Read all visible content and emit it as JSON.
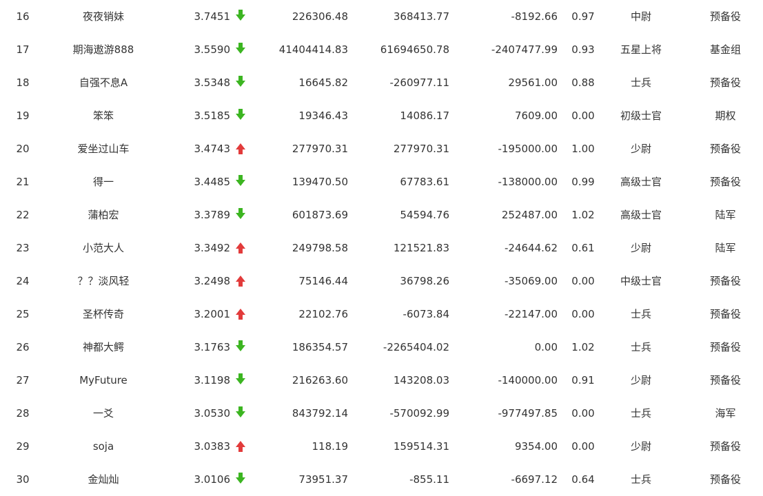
{
  "colors": {
    "text": "#333333",
    "down_arrow": "#3cb521",
    "up_arrow": "#e23b3b",
    "background": "#ffffff"
  },
  "rows": [
    {
      "rank": "16",
      "name": "夜夜销妹",
      "score": "3.7451",
      "trend": "down",
      "v1": "226306.48",
      "v2": "368413.77",
      "v3": "-8192.66",
      "ratio": "0.97",
      "level": "中尉",
      "group": "预备役"
    },
    {
      "rank": "17",
      "name": "期海遨游888",
      "score": "3.5590",
      "trend": "down",
      "v1": "41404414.83",
      "v2": "61694650.78",
      "v3": "-2407477.99",
      "ratio": "0.93",
      "level": "五星上将",
      "group": "基金组"
    },
    {
      "rank": "18",
      "name": "自强不息A",
      "score": "3.5348",
      "trend": "down",
      "v1": "16645.82",
      "v2": "-260977.11",
      "v3": "29561.00",
      "ratio": "0.88",
      "level": "士兵",
      "group": "预备役"
    },
    {
      "rank": "19",
      "name": "笨笨",
      "score": "3.5185",
      "trend": "down",
      "v1": "19346.43",
      "v2": "14086.17",
      "v3": "7609.00",
      "ratio": "0.00",
      "level": "初级士官",
      "group": "期权"
    },
    {
      "rank": "20",
      "name": "爱坐过山车",
      "score": "3.4743",
      "trend": "up",
      "v1": "277970.31",
      "v2": "277970.31",
      "v3": "-195000.00",
      "ratio": "1.00",
      "level": "少尉",
      "group": "预备役"
    },
    {
      "rank": "21",
      "name": "得一",
      "score": "3.4485",
      "trend": "down",
      "v1": "139470.50",
      "v2": "67783.61",
      "v3": "-138000.00",
      "ratio": "0.99",
      "level": "高级士官",
      "group": "预备役"
    },
    {
      "rank": "22",
      "name": "蒲柏宏",
      "score": "3.3789",
      "trend": "down",
      "v1": "601873.69",
      "v2": "54594.76",
      "v3": "252487.00",
      "ratio": "1.02",
      "level": "高级士官",
      "group": "陆军"
    },
    {
      "rank": "23",
      "name": "小范大人",
      "score": "3.3492",
      "trend": "up",
      "v1": "249798.58",
      "v2": "121521.83",
      "v3": "-24644.62",
      "ratio": "0.61",
      "level": "少尉",
      "group": "陆军"
    },
    {
      "rank": "24",
      "name": "？？淡风轻",
      "score": "3.2498",
      "trend": "up",
      "v1": "75146.44",
      "v2": "36798.26",
      "v3": "-35069.00",
      "ratio": "0.00",
      "level": "中级士官",
      "group": "预备役"
    },
    {
      "rank": "25",
      "name": "圣杯传奇",
      "score": "3.2001",
      "trend": "up",
      "v1": "22102.76",
      "v2": "-6073.84",
      "v3": "-22147.00",
      "ratio": "0.00",
      "level": "士兵",
      "group": "预备役"
    },
    {
      "rank": "26",
      "name": "神都大鳄",
      "score": "3.1763",
      "trend": "down",
      "v1": "186354.57",
      "v2": "-2265404.02",
      "v3": "0.00",
      "ratio": "1.02",
      "level": "士兵",
      "group": "预备役"
    },
    {
      "rank": "27",
      "name": "MyFuture",
      "score": "3.1198",
      "trend": "down",
      "v1": "216263.60",
      "v2": "143208.03",
      "v3": "-140000.00",
      "ratio": "0.91",
      "level": "少尉",
      "group": "预备役"
    },
    {
      "rank": "28",
      "name": "一爻",
      "score": "3.0530",
      "trend": "down",
      "v1": "843792.14",
      "v2": "-570092.99",
      "v3": "-977497.85",
      "ratio": "0.00",
      "level": "士兵",
      "group": "海军"
    },
    {
      "rank": "29",
      "name": "soja",
      "score": "3.0383",
      "trend": "up",
      "v1": "118.19",
      "v2": "159514.31",
      "v3": "9354.00",
      "ratio": "0.00",
      "level": "少尉",
      "group": "预备役"
    },
    {
      "rank": "30",
      "name": "金灿灿",
      "score": "3.0106",
      "trend": "down",
      "v1": "73951.37",
      "v2": "-855.11",
      "v3": "-6697.12",
      "ratio": "0.64",
      "level": "士兵",
      "group": "预备役"
    }
  ]
}
